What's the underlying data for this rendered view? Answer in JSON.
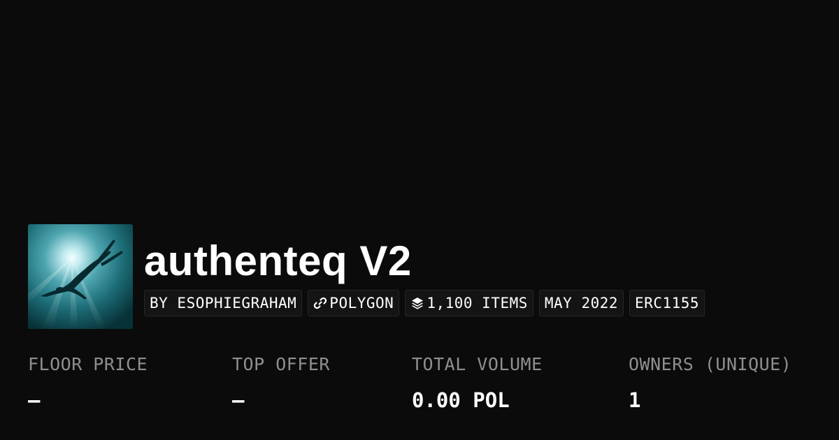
{
  "collection": {
    "title": "authenteq V2",
    "avatar_description_icon": "swimmer-underwater-image"
  },
  "chips": {
    "creator": "BY ESOPHIEGRAHAM",
    "chain_icon": "link-icon",
    "chain": "POLYGON",
    "items_icon": "layers-icon",
    "items": "1,100 ITEMS",
    "date": "MAY 2022",
    "standard": "ERC1155"
  },
  "stats": {
    "floor_price": {
      "label": "FLOOR PRICE",
      "value": "–"
    },
    "top_offer": {
      "label": "TOP OFFER",
      "value": "–"
    },
    "total_volume": {
      "label": "TOTAL VOLUME",
      "value": "0.00 POL"
    },
    "owners": {
      "label": "OWNERS (UNIQUE)",
      "value": "1"
    }
  },
  "colors": {
    "background": "#0b0b0b",
    "label": "#8f8f8f",
    "chip_bg": "#141414",
    "chip_border": "#262626",
    "water": "#0b4047"
  }
}
